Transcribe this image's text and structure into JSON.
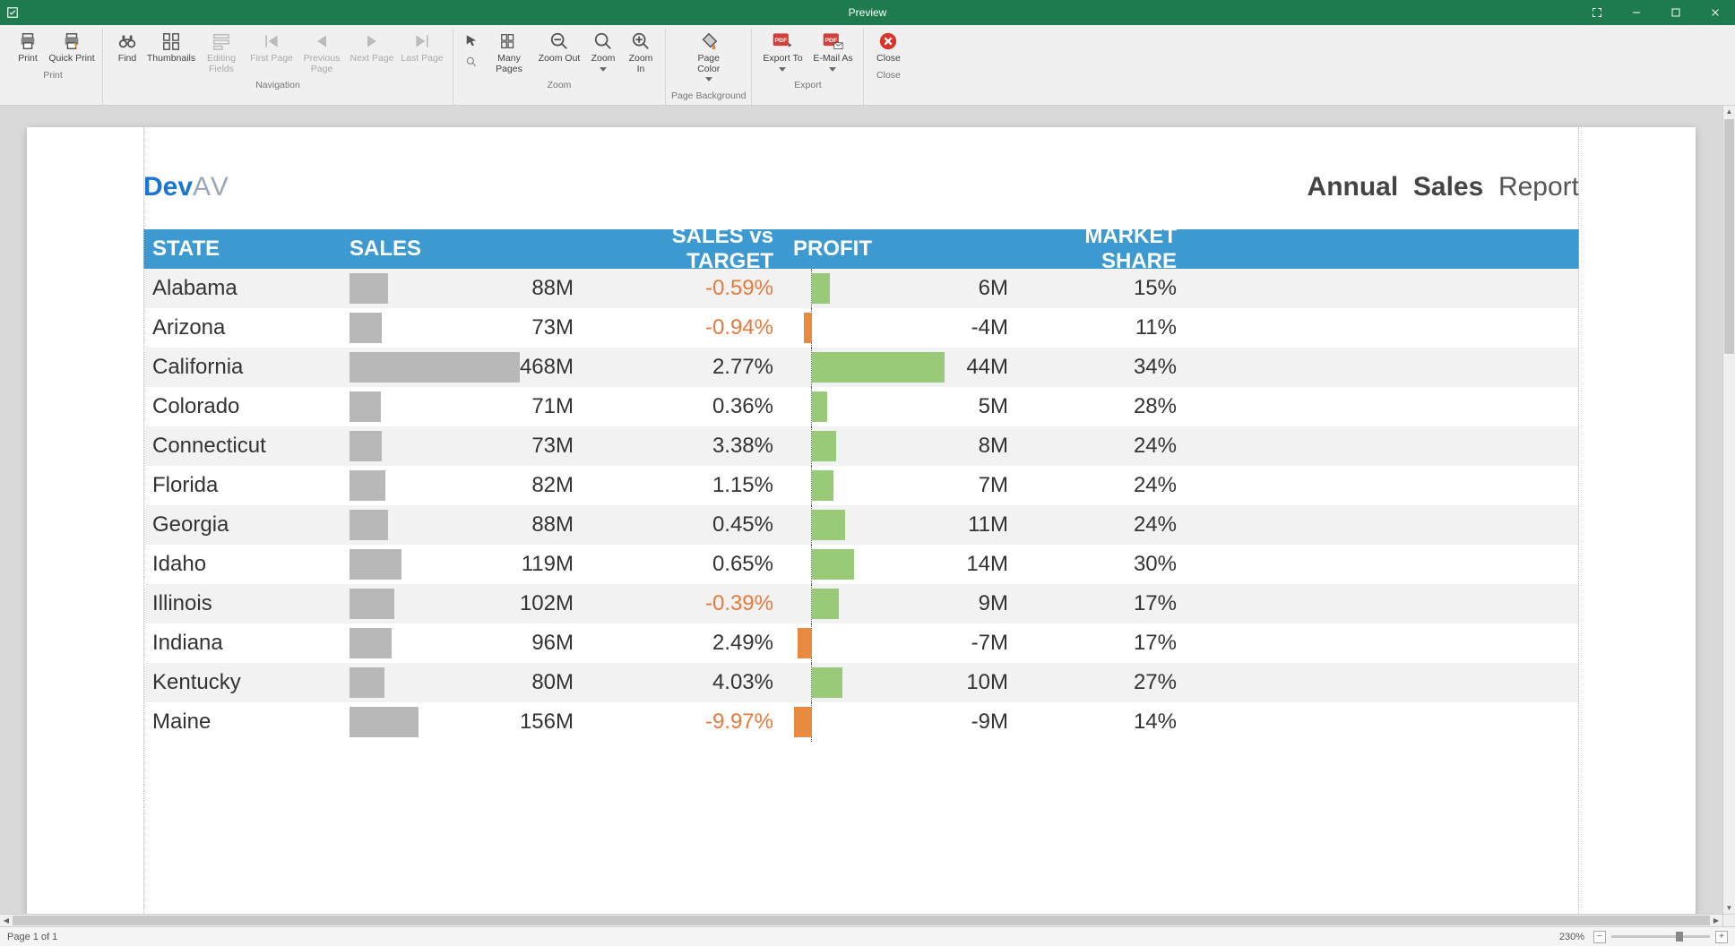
{
  "window": {
    "title": "Preview"
  },
  "ribbon": {
    "groups": [
      {
        "label": "Print",
        "buttons": [
          {
            "id": "print",
            "label": "Print",
            "icon": "printer"
          },
          {
            "id": "quick-print",
            "label": "Quick Print",
            "icon": "printer-bolt"
          }
        ]
      },
      {
        "label": "Navigation",
        "buttons": [
          {
            "id": "find",
            "label": "Find",
            "icon": "binoculars"
          },
          {
            "id": "thumbnails",
            "label": "Thumbnails",
            "icon": "thumbs"
          },
          {
            "id": "editing-fields",
            "label": "Editing Fields",
            "icon": "edit-fields",
            "disabled": true
          },
          {
            "id": "first-page",
            "label": "First Page",
            "icon": "first",
            "disabled": true
          },
          {
            "id": "prev-page",
            "label": "Previous Page",
            "icon": "prev",
            "disabled": true
          },
          {
            "id": "next-page",
            "label": "Next Page",
            "icon": "next",
            "disabled": true
          },
          {
            "id": "last-page",
            "label": "Last Page",
            "icon": "last",
            "disabled": true
          }
        ]
      },
      {
        "label": "Zoom",
        "buttons": [
          {
            "id": "pointer",
            "label": "",
            "icon": "pointer"
          },
          {
            "id": "many-pages",
            "label": "Many Pages",
            "icon": "many-pages"
          },
          {
            "id": "zoom-out",
            "label": "Zoom Out",
            "icon": "zoom-out"
          },
          {
            "id": "zoom",
            "label": "Zoom",
            "icon": "zoom",
            "dropdown": true
          },
          {
            "id": "zoom-in",
            "label": "Zoom In",
            "icon": "zoom-in"
          }
        ]
      },
      {
        "label": "Page Background",
        "buttons": [
          {
            "id": "page-color",
            "label": "Page Color",
            "icon": "bucket",
            "dropdown": true
          }
        ]
      },
      {
        "label": "Export",
        "buttons": [
          {
            "id": "export-to",
            "label": "Export To",
            "icon": "pdf-export",
            "dropdown": true
          },
          {
            "id": "email-as",
            "label": "E-Mail As",
            "icon": "pdf-mail",
            "dropdown": true
          }
        ]
      },
      {
        "label": "Close",
        "buttons": [
          {
            "id": "close",
            "label": "Close",
            "icon": "close-red"
          }
        ]
      }
    ]
  },
  "report": {
    "logo": {
      "part1": "Dev",
      "part2": "AV"
    },
    "title": {
      "bold1": "Annual",
      "bold2": "Sales",
      "rest": "Report"
    },
    "columns": [
      "STATE",
      "SALES",
      "SALES vs TARGET",
      "PROFIT",
      "MARKET SHARE"
    ],
    "maxSales": 468,
    "maxProfit": 44,
    "rows": [
      {
        "state": "Alabama",
        "sales": 88,
        "sales_label": "88M",
        "svt": "-0.59%",
        "svt_neg": true,
        "profit": 6,
        "profit_label": "6M",
        "ms": "15%"
      },
      {
        "state": "Arizona",
        "sales": 73,
        "sales_label": "73M",
        "svt": "-0.94%",
        "svt_neg": true,
        "profit": -4,
        "profit_label": "-4M",
        "ms": "11%"
      },
      {
        "state": "California",
        "sales": 468,
        "sales_label": "468M",
        "svt": "2.77%",
        "svt_neg": false,
        "profit": 44,
        "profit_label": "44M",
        "ms": "34%"
      },
      {
        "state": "Colorado",
        "sales": 71,
        "sales_label": "71M",
        "svt": "0.36%",
        "svt_neg": false,
        "profit": 5,
        "profit_label": "5M",
        "ms": "28%"
      },
      {
        "state": "Connecticut",
        "sales": 73,
        "sales_label": "73M",
        "svt": "3.38%",
        "svt_neg": false,
        "profit": 8,
        "profit_label": "8M",
        "ms": "24%"
      },
      {
        "state": "Florida",
        "sales": 82,
        "sales_label": "82M",
        "svt": "1.15%",
        "svt_neg": false,
        "profit": 7,
        "profit_label": "7M",
        "ms": "24%"
      },
      {
        "state": "Georgia",
        "sales": 88,
        "sales_label": "88M",
        "svt": "0.45%",
        "svt_neg": false,
        "profit": 11,
        "profit_label": "11M",
        "ms": "24%"
      },
      {
        "state": "Idaho",
        "sales": 119,
        "sales_label": "119M",
        "svt": "0.65%",
        "svt_neg": false,
        "profit": 14,
        "profit_label": "14M",
        "ms": "30%"
      },
      {
        "state": "Illinois",
        "sales": 102,
        "sales_label": "102M",
        "svt": "-0.39%",
        "svt_neg": true,
        "profit": 9,
        "profit_label": "9M",
        "ms": "17%"
      },
      {
        "state": "Indiana",
        "sales": 96,
        "sales_label": "96M",
        "svt": "2.49%",
        "svt_neg": false,
        "profit": -7,
        "profit_label": "-7M",
        "ms": "17%"
      },
      {
        "state": "Kentucky",
        "sales": 80,
        "sales_label": "80M",
        "svt": "4.03%",
        "svt_neg": false,
        "profit": 10,
        "profit_label": "10M",
        "ms": "27%"
      },
      {
        "state": "Maine",
        "sales": 156,
        "sales_label": "156M",
        "svt": "-9.97%",
        "svt_neg": true,
        "profit": -9,
        "profit_label": "-9M",
        "ms": "14%"
      }
    ]
  },
  "status": {
    "page_text": "Page 1 of 1",
    "zoom": "230%"
  },
  "chart_data": {
    "type": "table",
    "title": "Annual Sales Report",
    "columns": [
      "STATE",
      "SALES (M)",
      "SALES vs TARGET (%)",
      "PROFIT (M)",
      "MARKET SHARE (%)"
    ],
    "rows": [
      [
        "Alabama",
        88,
        -0.59,
        6,
        15
      ],
      [
        "Arizona",
        73,
        -0.94,
        -4,
        11
      ],
      [
        "California",
        468,
        2.77,
        44,
        34
      ],
      [
        "Colorado",
        71,
        0.36,
        5,
        28
      ],
      [
        "Connecticut",
        73,
        3.38,
        8,
        24
      ],
      [
        "Florida",
        82,
        1.15,
        7,
        24
      ],
      [
        "Georgia",
        88,
        0.45,
        11,
        24
      ],
      [
        "Idaho",
        119,
        0.65,
        14,
        30
      ],
      [
        "Illinois",
        102,
        -0.39,
        9,
        17
      ],
      [
        "Indiana",
        96,
        2.49,
        -7,
        17
      ],
      [
        "Kentucky",
        80,
        4.03,
        10,
        27
      ],
      [
        "Maine",
        156,
        -9.97,
        -9,
        14
      ]
    ]
  }
}
